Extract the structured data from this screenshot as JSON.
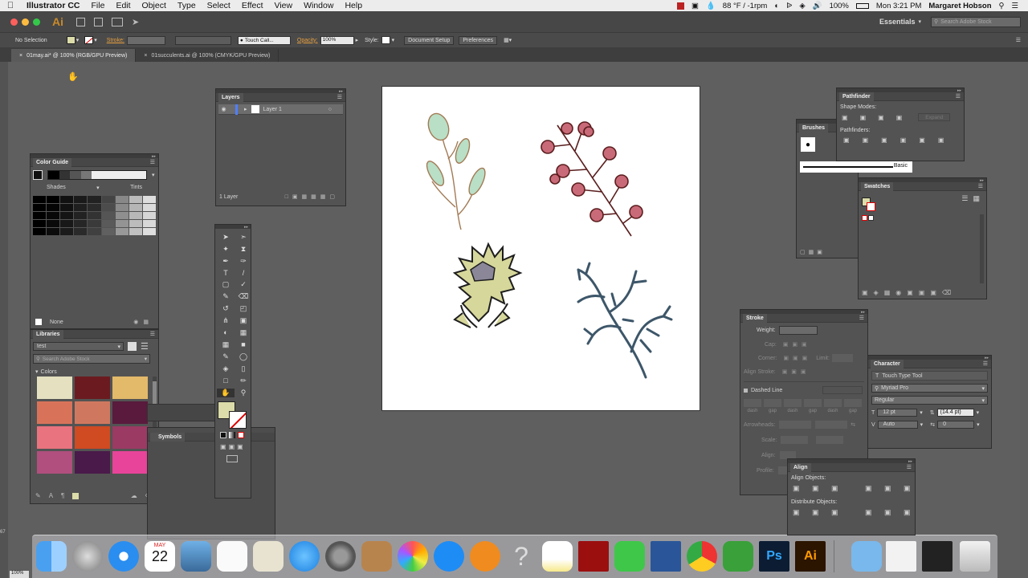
{
  "menubar": {
    "app": "Illustrator CC",
    "items": [
      "File",
      "Edit",
      "Object",
      "Type",
      "Select",
      "Effect",
      "View",
      "Window",
      "Help"
    ],
    "weather": "88 °F / -1rpm",
    "battery": "100%",
    "clock": "Mon 3:21 PM",
    "user": "Margaret Hobson"
  },
  "titlebar": {
    "logo": "Ai",
    "workspace": "Essentials",
    "search_placeholder": "Search Adobe Stock"
  },
  "controlbar": {
    "selection": "No Selection",
    "stroke_label": "Stroke:",
    "brush": "Touch Call...",
    "opacity_label": "Opacity:",
    "opacity_value": "100%",
    "style_label": "Style:",
    "doc_setup": "Document Setup",
    "preferences": "Preferences"
  },
  "tabs": [
    {
      "label": "01may.ai* @ 100% (RGB/GPU Preview)"
    },
    {
      "label": "01succulents.ai @ 100% (CMYK/GPU Preview)"
    }
  ],
  "layers": {
    "title": "Layers",
    "layer_name": "Layer 1",
    "count": "1 Layer"
  },
  "color_guide": {
    "title": "Color Guide",
    "shades": "Shades",
    "tints": "Tints",
    "none": "None"
  },
  "libraries": {
    "title": "Libraries",
    "library": "test",
    "search_placeholder": "Search Adobe Stock",
    "colors_label": "Colors",
    "colors": [
      "#e4e0c0",
      "#6b1b1f",
      "#e3b96a",
      "#d8735a",
      "#d0785f",
      "#5a1a3d",
      "#e9737f",
      "#d04a22",
      "#9b3a63",
      "#b14f7e",
      "#4a1a4a",
      "#e8449a"
    ]
  },
  "symbols": {
    "title": "Symbols"
  },
  "brushes": {
    "title": "Brushes",
    "basic": "Basic"
  },
  "pathfinder": {
    "title": "Pathfinder",
    "shape_modes": "Shape Modes:",
    "pathfinders": "Pathfinders:",
    "expand": "Expand"
  },
  "swatches": {
    "title": "Swatches"
  },
  "stroke": {
    "title": "Stroke",
    "weight": "Weight:",
    "cap": "Cap:",
    "corner": "Corner:",
    "limit": "Limit:",
    "align_stroke": "Align Stroke:",
    "dashed_line": "Dashed Line",
    "dash_labels": [
      "dash",
      "gap",
      "dash",
      "gap",
      "dash",
      "gap"
    ],
    "arrowheads": "Arrowheads:",
    "scale": "Scale:",
    "align": "Align:",
    "profile": "Profile:"
  },
  "character": {
    "title": "Character",
    "touch_type": "Touch Type Tool",
    "font": "Myriad Pro",
    "style": "Regular",
    "size": "12 pt",
    "leading": "(14.4 pt)",
    "kerning": "Auto",
    "tracking": "0"
  },
  "align": {
    "title": "Align",
    "align_objects": "Align Objects:",
    "distribute_objects": "Distribute Objects:"
  },
  "status": {
    "zoom": "100%",
    "coord": "67"
  },
  "dock": {
    "calendar_month": "MAY",
    "calendar_day": "22",
    "ps": "Ps",
    "ai": "Ai"
  }
}
